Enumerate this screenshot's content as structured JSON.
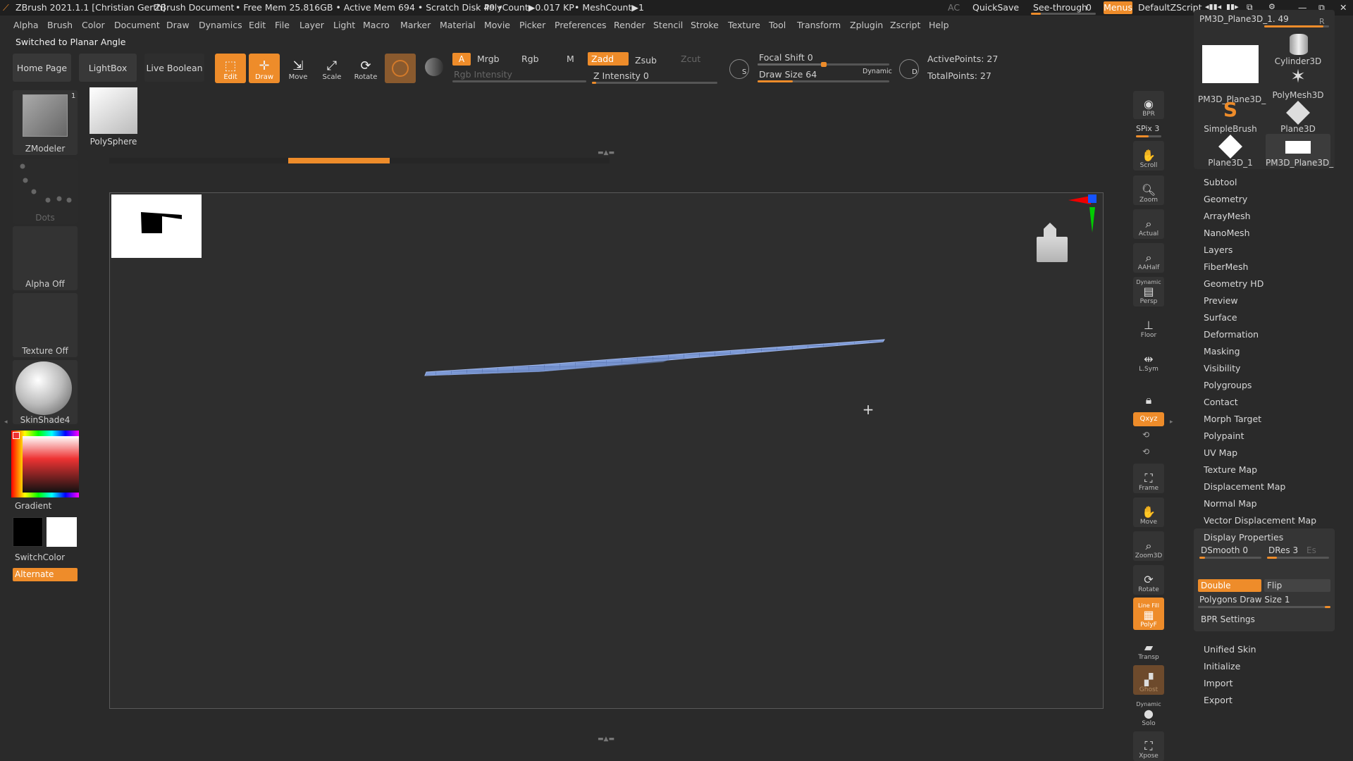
{
  "titlebar": {
    "app": "ZBrush 2021.1.1 [Christian Gerth]",
    "document": "ZBrush Document",
    "stats": "• Free Mem 25.816GB • Active Mem 694 • Scratch Disk 49 • ",
    "polycount": "PolyCount▶0.017 KP",
    "meshcount": "• MeshCount▶1",
    "ac": "AC",
    "quicksave": "QuickSave",
    "seethrough": "See-through",
    "seethrough_value": "0",
    "seethrough_level": 0,
    "menus": "Menus",
    "script": "DefaultZScript"
  },
  "menu": [
    "Alpha",
    "Brush",
    "Color",
    "Document",
    "Draw",
    "Dynamics",
    "Edit",
    "File",
    "Layer",
    "Light",
    "Macro",
    "Marker",
    "Material",
    "Movie",
    "Picker",
    "Preferences",
    "Render",
    "Stencil",
    "Stroke",
    "Texture",
    "Tool",
    "Transform",
    "Zplugin",
    "Zscript",
    "Help"
  ],
  "notice": "Switched to Planar Angle",
  "shelf": {
    "home": "Home Page",
    "lightbox": "LightBox",
    "liveboolean": "Live Boolean",
    "edit": "Edit",
    "draw": "Draw",
    "move": "Move",
    "scale": "Scale",
    "rotate": "Rotate",
    "a": "A",
    "mrgb": "Mrgb",
    "rgb": "Rgb",
    "m": "M",
    "zadd": "Zadd",
    "zsub": "Zsub",
    "zcut": "Zcut",
    "rgb_intensity": "Rgb Intensity",
    "z_intensity": "Z Intensity 0",
    "focal_shift": "Focal Shift 0",
    "draw_size": "Draw Size 64",
    "dynamic": "Dynamic",
    "active_points": "ActivePoints: 27",
    "total_points": "TotalPoints: 27"
  },
  "leftpanel": {
    "zmodeler": "ZModeler",
    "zmodeler_count": "1",
    "polysphere": "PolySphere",
    "dots": "Dots",
    "alpha": "Alpha Off",
    "texture": "Texture Off",
    "material": "SkinShade4",
    "gradient": "Gradient",
    "switchcolor": "SwitchColor",
    "alternate": "Alternate"
  },
  "righttools": [
    "BPR",
    "Scroll",
    "Zoom",
    "Actual",
    "AAHalf",
    "Persp",
    "Floor",
    "L.Sym",
    "",
    "Frame",
    "Move",
    "Zoom3D",
    "Rotate",
    "PolyF",
    "Transp",
    "Ghost",
    "Solo",
    "Xpose"
  ],
  "righttool_labels": {
    "spix": "SPix 3",
    "dynamic": "Dynamic",
    "xyz": "Qxyz",
    "linefill": "Line Fill"
  },
  "palette": {
    "current": "PM3D_Plane3D_1. 49",
    "r": "R",
    "items": [
      "PM3D_Plane3D_",
      "Cylinder3D",
      "PolyMesh3D",
      "SimpleBrush",
      "Plane3D",
      "Plane3D_1",
      "PM3D_Plane3D_"
    ]
  },
  "subpalettes": [
    "Subtool",
    "Geometry",
    "ArrayMesh",
    "NanoMesh",
    "Layers",
    "FiberMesh",
    "Geometry HD",
    "Preview",
    "Surface",
    "Deformation",
    "Masking",
    "Visibility",
    "Polygroups",
    "Contact",
    "Morph Target",
    "Polypaint",
    "UV Map",
    "Texture Map",
    "Displacement Map",
    "Normal Map",
    "Vector Displacement Map"
  ],
  "display_properties": {
    "title": "Display Properties",
    "dsmooth": "DSmooth 0",
    "dres": "DRes 3",
    "es": "Es",
    "double": "Double",
    "flip": "Flip",
    "poly_draw_size": "Polygons Draw Size 1",
    "bpr": "BPR Settings"
  },
  "bottom_palettes": [
    "Unified Skin",
    "Initialize",
    "Import",
    "Export"
  ],
  "colors": {
    "accent": "#ee8c2a",
    "bg": "#2a2a2a",
    "mesh": "#7d9ad6"
  }
}
